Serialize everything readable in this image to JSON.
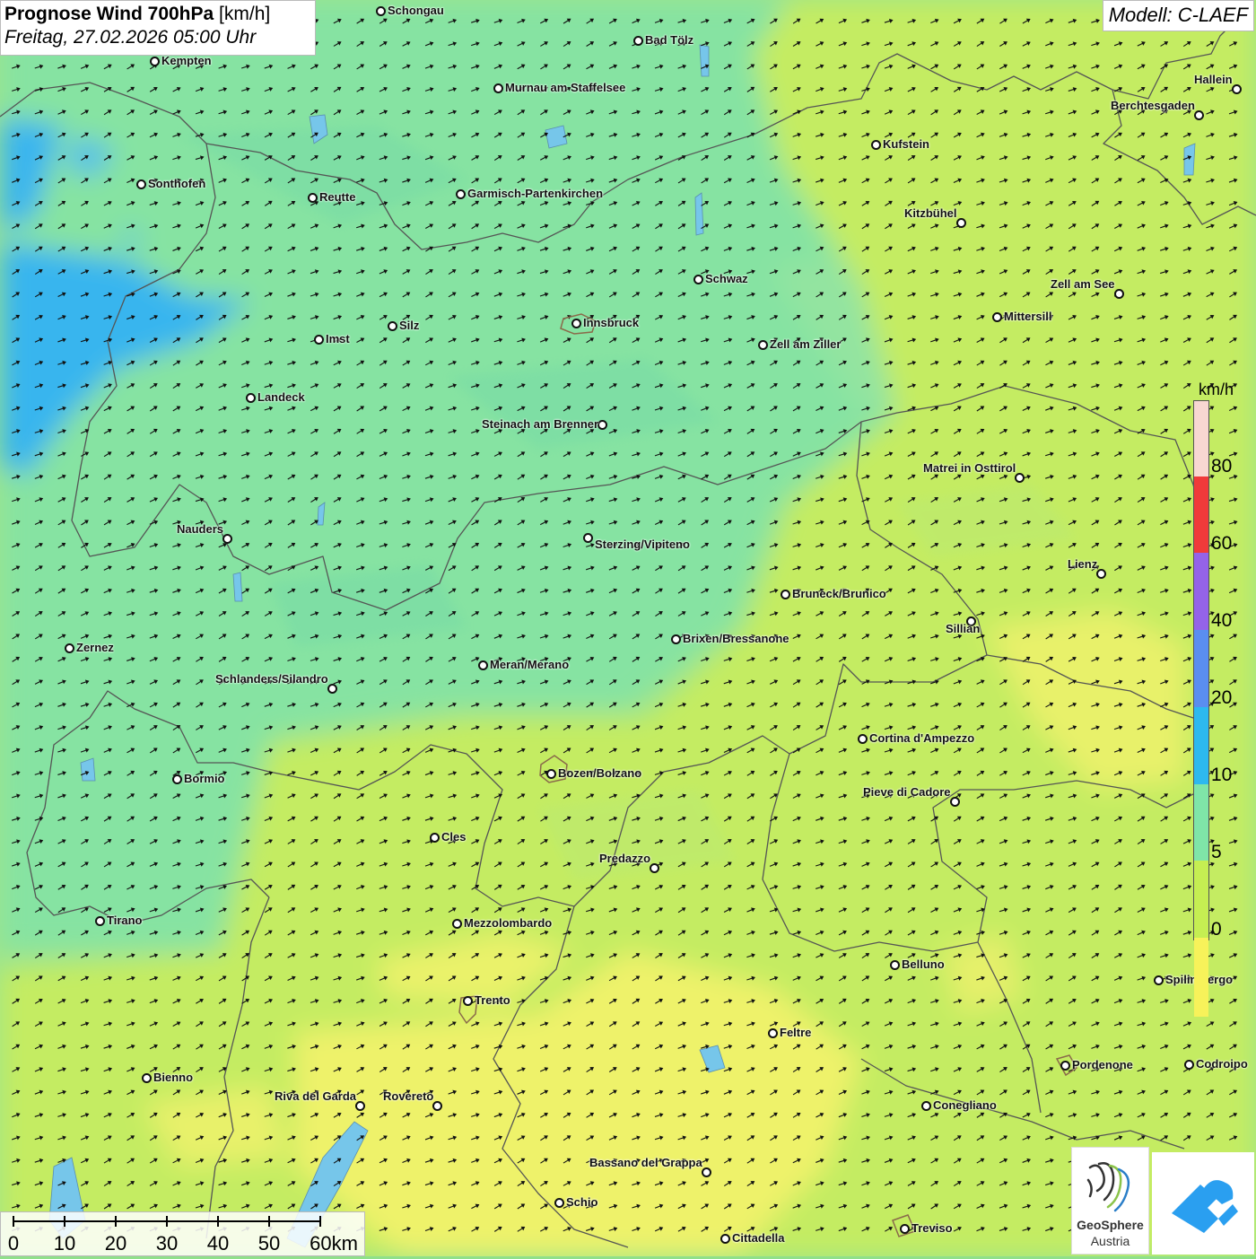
{
  "header": {
    "title_bold": "Prognose Wind 700hPa",
    "title_unit": "[km/h]",
    "datetime": "Freitag, 27.02.2026 05:00 Uhr"
  },
  "model_label": "Modell: C-LAEF",
  "legend": {
    "unit": "km/h",
    "ticks": [
      "0",
      "5",
      "10",
      "20",
      "40",
      "60",
      "80"
    ],
    "colors": [
      "#f7f25a",
      "#c5ee52",
      "#7fe5a8",
      "#2db9ef",
      "#5a8ef0",
      "#9463e8",
      "#f03a3a",
      "#f8d7d2"
    ]
  },
  "scale": {
    "labels": [
      "0",
      "10",
      "20",
      "30",
      "40",
      "50",
      "60km"
    ]
  },
  "logo": {
    "name": "GeoSphere",
    "sub": "Austria"
  },
  "wind": {
    "direction": "north-east"
  },
  "cities": [
    {
      "name": "Schongau",
      "key": "schongau"
    },
    {
      "name": "Bad Tölz",
      "key": "bad-toelz"
    },
    {
      "name": "Kempten",
      "key": "kempten"
    },
    {
      "name": "Murnau am Staffelsee",
      "key": "murnau"
    },
    {
      "name": "Hallein",
      "key": "hallein"
    },
    {
      "name": "Berchtesgaden",
      "key": "berchtesgaden"
    },
    {
      "name": "Kufstein",
      "key": "kufstein"
    },
    {
      "name": "Sonthofen",
      "key": "sonthofen"
    },
    {
      "name": "Reutte",
      "key": "reutte"
    },
    {
      "name": "Garmisch-Partenkirchen",
      "key": "garmisch"
    },
    {
      "name": "Kitzbühel",
      "key": "kitzbuehel"
    },
    {
      "name": "Schwaz",
      "key": "schwaz"
    },
    {
      "name": "Zell am See",
      "key": "zell-am-see"
    },
    {
      "name": "Mittersill",
      "key": "mittersill"
    },
    {
      "name": "Innsbruck",
      "key": "innsbruck"
    },
    {
      "name": "Silz",
      "key": "silz"
    },
    {
      "name": "Imst",
      "key": "imst"
    },
    {
      "name": "Zell am Ziller",
      "key": "zell-am-ziller"
    },
    {
      "name": "Landeck",
      "key": "landeck"
    },
    {
      "name": "Steinach am Brenner",
      "key": "steinach"
    },
    {
      "name": "Matrei in Osttirol",
      "key": "matrei"
    },
    {
      "name": "Nauders",
      "key": "nauders"
    },
    {
      "name": "Sterzing/Vipiteno",
      "key": "sterzing"
    },
    {
      "name": "Lienz",
      "key": "lienz"
    },
    {
      "name": "Bruneck/Brunico",
      "key": "bruneck"
    },
    {
      "name": "Sillian",
      "key": "sillian"
    },
    {
      "name": "Brixen/Bressanone",
      "key": "brixen"
    },
    {
      "name": "Zernez",
      "key": "zernez"
    },
    {
      "name": "Meran/Merano",
      "key": "meran"
    },
    {
      "name": "Schlanders/Silandro",
      "key": "schlanders"
    },
    {
      "name": "Cortina d'Ampezzo",
      "key": "cortina"
    },
    {
      "name": "Bozen/Bolzano",
      "key": "bozen"
    },
    {
      "name": "Bormio",
      "key": "bormio"
    },
    {
      "name": "Pieve di Cadore",
      "key": "pieve"
    },
    {
      "name": "Cles",
      "key": "cles"
    },
    {
      "name": "Predazzo",
      "key": "predazzo"
    },
    {
      "name": "Tirano",
      "key": "tirano"
    },
    {
      "name": "Mezzolombardo",
      "key": "mezzolombardo"
    },
    {
      "name": "Belluno",
      "key": "belluno"
    },
    {
      "name": "Spilimbergo",
      "key": "spilimbergo"
    },
    {
      "name": "Trento",
      "key": "trento"
    },
    {
      "name": "Feltre",
      "key": "feltre"
    },
    {
      "name": "Bienno",
      "key": "bienno"
    },
    {
      "name": "Pordenone",
      "key": "pordenone"
    },
    {
      "name": "Codroipo",
      "key": "codroipo"
    },
    {
      "name": "Riva del Garda",
      "key": "riva"
    },
    {
      "name": "Rovereto",
      "key": "rovereto"
    },
    {
      "name": "Conegliano",
      "key": "conegliano"
    },
    {
      "name": "Bassano del Grappa",
      "key": "bassano"
    },
    {
      "name": "Schio",
      "key": "schio"
    },
    {
      "name": "Treviso",
      "key": "treviso"
    },
    {
      "name": "Cittadella",
      "key": "cittadella"
    }
  ]
}
